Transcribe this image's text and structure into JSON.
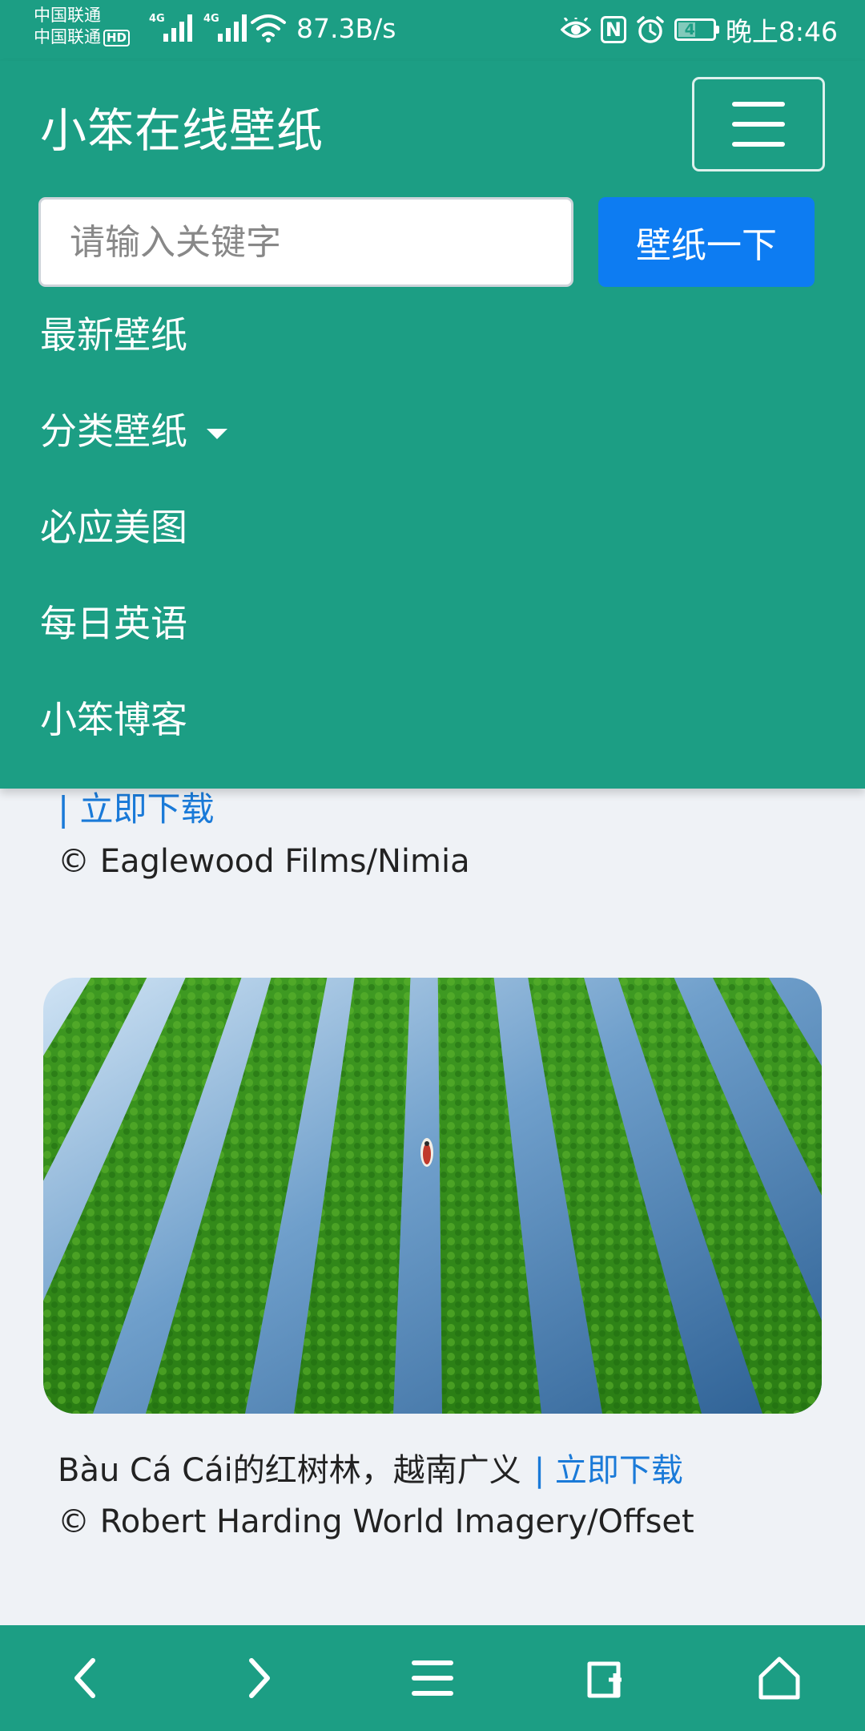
{
  "status_bar": {
    "carrier_1": "中国联通",
    "carrier_2": "中国联通",
    "hd_badge": "HD",
    "signal_gen_1": "4G",
    "signal_gen_2": "4G",
    "net_speed": "87.3B/s",
    "battery_level": "46",
    "battery_fraction": 0.46,
    "time": "晚上8:46",
    "icons": [
      "eye-icon",
      "nfc-icon",
      "alarm-icon",
      "battery-icon",
      "wifi-icon",
      "signal-icon"
    ]
  },
  "navbar": {
    "brand": "小笨在线壁纸",
    "toggle_icon": "hamburger-icon",
    "search": {
      "placeholder": "请输入关键字",
      "button_label": "壁纸一下"
    },
    "items": [
      {
        "label": "最新壁纸"
      },
      {
        "label": "分类壁纸",
        "dropdown": true
      },
      {
        "label": "必应美图"
      },
      {
        "label": "每日英语"
      },
      {
        "label": "小笨博客"
      }
    ]
  },
  "content": {
    "partial_card": {
      "download_label": "| 立即下载",
      "credit": "© Eaglewood Films/Nimia"
    },
    "card": {
      "image_subject": "aerial view of mangrove rows in water with a small boat",
      "caption": "Bàu Cá Cái的红树林，越南广义",
      "download_label": "| 立即下载",
      "credit": "© Robert Harding World Imagery/Offset"
    }
  },
  "bottom_bar": {
    "icons": [
      "back-arrow-icon",
      "forward-arrow-icon",
      "menu-icon",
      "tabs-icon",
      "home-icon"
    ]
  },
  "colors": {
    "primary": "#1c9e84",
    "button_blue": "#0d7cf2",
    "link_blue": "#1a7ad8",
    "page_background": "#eff2f6"
  }
}
